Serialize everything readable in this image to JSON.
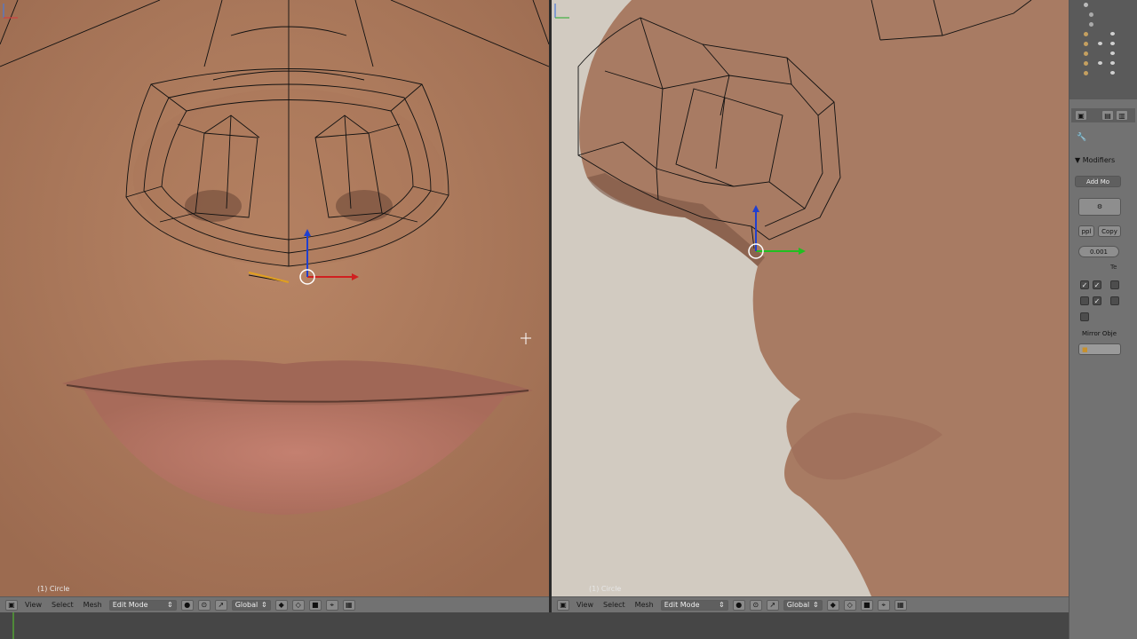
{
  "viewport_left": {
    "object_label": "(1) Circle",
    "header": {
      "menus": [
        "View",
        "Select",
        "Mesh"
      ],
      "mode": "Edit Mode",
      "orientation": "Global"
    }
  },
  "viewport_right": {
    "object_label": "(1) Circle",
    "header": {
      "menus": [
        "View",
        "Select",
        "Mesh"
      ],
      "mode": "Edit Mode",
      "orientation": "Global"
    }
  },
  "properties": {
    "section_title": "Modifiers",
    "add_modifier": "Add Mo",
    "apply": "ppl",
    "copy": "Copy",
    "merge_limit": "0.001",
    "clipping_label": "Te",
    "mirror_object_label": "Mirror Obje"
  },
  "colors": {
    "accent_green": "#4f8a38",
    "panel_bg": "#727272",
    "header_bg": "#727272",
    "outliner_bg": "#5a5a5a"
  },
  "icons": [
    "editor-type-icon",
    "camera-icon",
    "eye-icon",
    "wrench-icon",
    "move-gizmo-icon",
    "cursor-icon"
  ]
}
